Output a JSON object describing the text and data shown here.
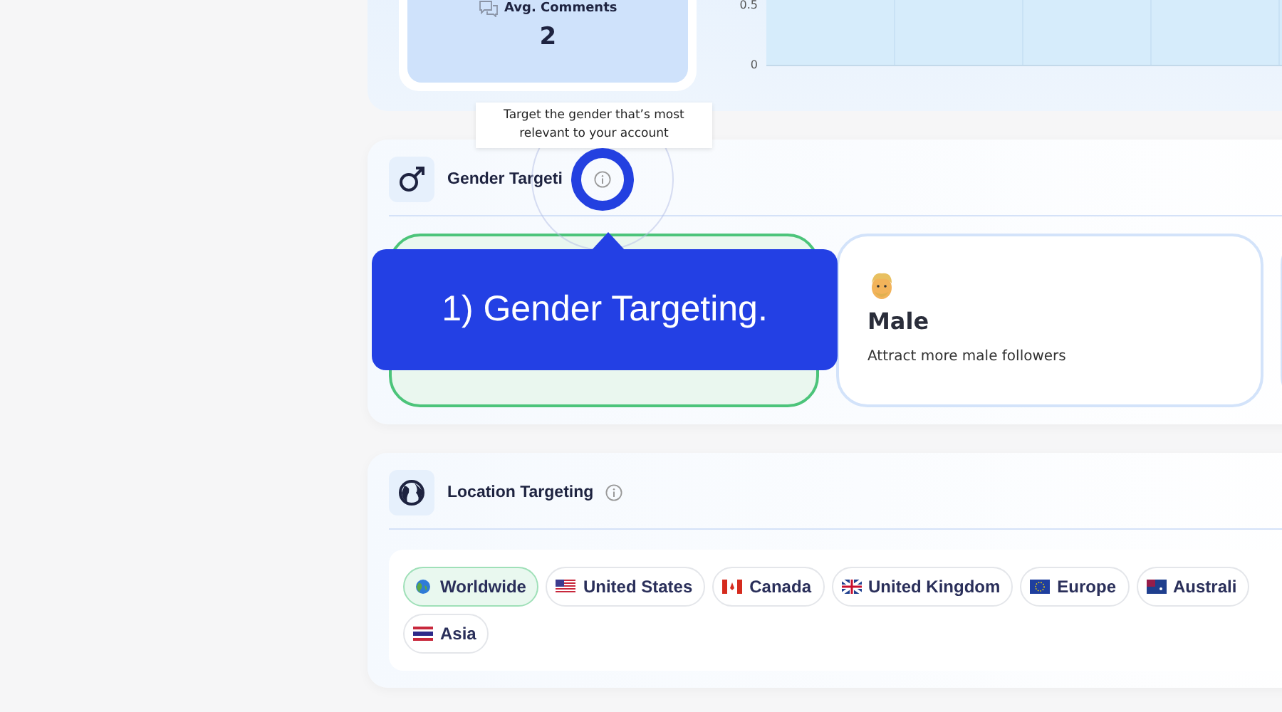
{
  "stats_panel": {
    "stat": {
      "label": "Avg. Comments",
      "value": "2"
    },
    "chart_y_ticks": [
      "0.5",
      "0"
    ]
  },
  "gender_targeting": {
    "title": "Gender Targeti",
    "tooltip": "Target the gender that’s most relevant to your account",
    "options": [
      {
        "kind": "hidden",
        "selected": true
      },
      {
        "kind": "card",
        "selected": false,
        "title": "Male",
        "description": "Attract more male followers"
      },
      {
        "kind": "edge",
        "selected": false
      }
    ]
  },
  "tutorial_callout": {
    "text": "1) Gender Targeting."
  },
  "location_targeting": {
    "title": "Location Targeting",
    "locations": [
      {
        "label": "Worldwide",
        "kind": "globe",
        "selected": true
      },
      {
        "label": "United States",
        "kind": "us",
        "selected": false
      },
      {
        "label": "Canada",
        "kind": "ca",
        "selected": false
      },
      {
        "label": "United Kingdom",
        "kind": "uk",
        "selected": false
      },
      {
        "label": "Europe",
        "kind": "eu",
        "selected": false
      },
      {
        "label": "Australi",
        "kind": "au",
        "selected": false
      },
      {
        "label": "Asia",
        "kind": "th",
        "selected": false
      }
    ]
  }
}
